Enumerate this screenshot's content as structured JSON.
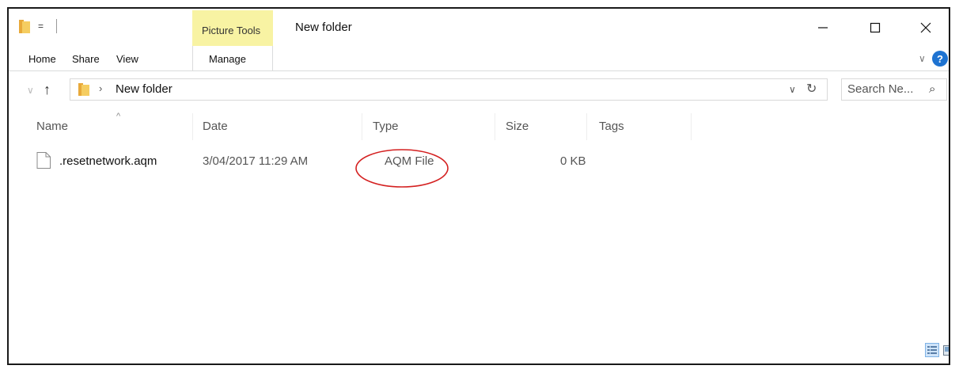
{
  "window": {
    "title": "New folder",
    "context_tab_label": "Picture Tools",
    "qat_dropdown_glyph": "=",
    "minimize_glyph": "–",
    "maximize_glyph": "☐",
    "close_glyph": "✕"
  },
  "ribbon": {
    "tabs": [
      {
        "label": "Home"
      },
      {
        "label": "Share"
      },
      {
        "label": "View"
      },
      {
        "label": "Manage"
      }
    ],
    "expand_glyph": "∨",
    "help_glyph": "?"
  },
  "address_bar": {
    "back_glyph": "∨",
    "up_glyph": "↑",
    "separator_glyph": "›",
    "path": "New folder",
    "dropdown_glyph": "∨",
    "refresh_glyph": "↻"
  },
  "search": {
    "placeholder": "Search Ne...",
    "icon_glyph": "⌕"
  },
  "columns": {
    "sort_glyph": "^",
    "headers": [
      {
        "label": "Name"
      },
      {
        "label": "Date"
      },
      {
        "label": "Type"
      },
      {
        "label": "Size"
      },
      {
        "label": "Tags"
      }
    ]
  },
  "files": [
    {
      "name": ".resetnetwork.aqm",
      "date": "3/04/2017 11:29 AM",
      "type": "AQM File",
      "size": "0 KB",
      "type_highlighted": true
    }
  ],
  "colors": {
    "accent_blue": "#1e73d1",
    "context_tab_yellow": "#f8f3a3",
    "folder_yellow": "#f2c14e",
    "highlight_red": "#d42020"
  },
  "icons": {
    "folder": "folder-icon",
    "file": "generic-file-icon",
    "details_view": "details-view-icon",
    "tiles_view": "large-icons-view-icon"
  }
}
